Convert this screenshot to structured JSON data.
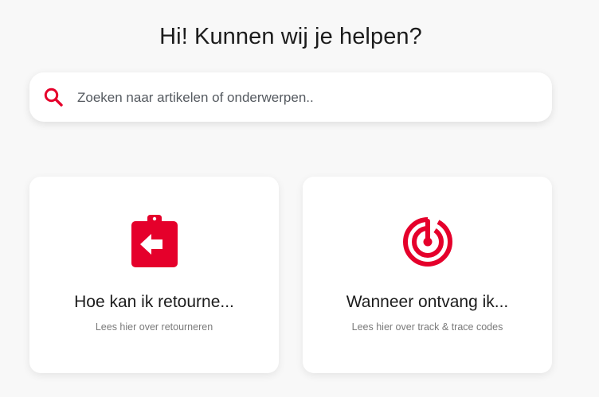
{
  "header": {
    "title": "Hi! Kunnen wij je helpen?"
  },
  "search": {
    "placeholder": "Zoeken naar artikelen of onderwerpen..",
    "icon": "search-icon"
  },
  "cards": [
    {
      "icon": "clipboard-return-icon",
      "title": "Hoe kan ik retourne...",
      "subtitle": "Lees hier over retourneren"
    },
    {
      "icon": "radar-tracking-icon",
      "title": "Wanneer ontvang ik...",
      "subtitle": "Lees hier over track & trace codes"
    }
  ],
  "colors": {
    "accent": "#e5002b",
    "background": "#f8f8f8",
    "card": "#ffffff"
  }
}
